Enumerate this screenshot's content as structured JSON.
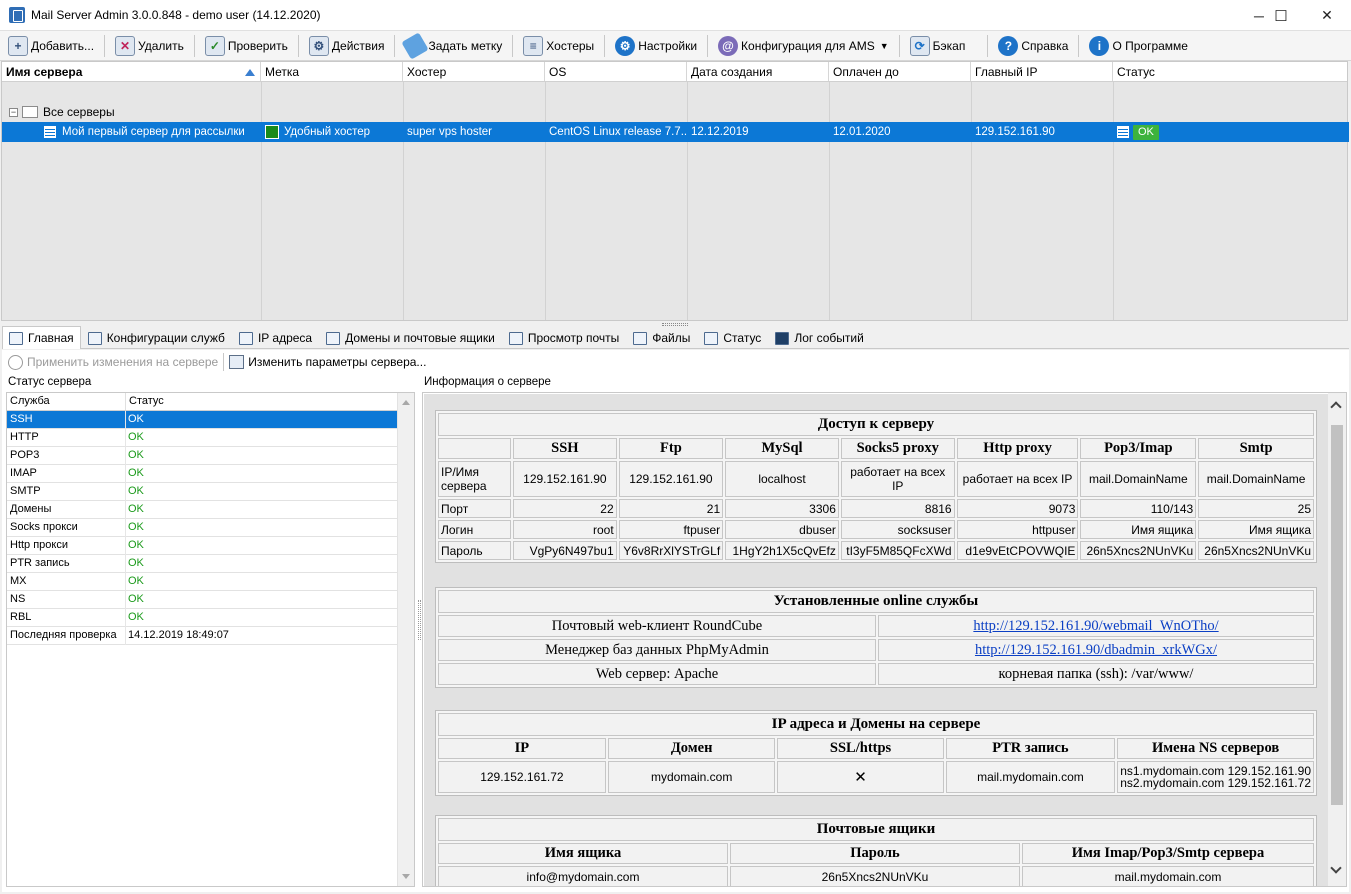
{
  "window": {
    "title": "Mail Server Admin 3.0.0.848 - demo user (14.12.2020)",
    "controls": {
      "minimize": "─",
      "maximize": "☐",
      "close": "✕"
    }
  },
  "toolbar": {
    "add": "Добавить...",
    "delete": "Удалить",
    "check": "Проверить",
    "actions": "Действия",
    "set_tag": "Задать метку",
    "hosters": "Хостеры",
    "settings": "Настройки",
    "ams_config": "Конфигурация для AMS",
    "backup": "Бэкап",
    "help": "Справка",
    "about": "О Программе"
  },
  "grid": {
    "columns": [
      "Имя сервера",
      "Метка",
      "Хостер",
      "OS",
      "Дата создания",
      "Оплачен до",
      "Главный IP",
      "Статус"
    ],
    "root_node": "Все серверы",
    "server_row": {
      "name": "Мой первый сервер для рассылки",
      "tag": "Удобный хостер",
      "tag_color": "#1a8a1a",
      "hoster": "super vps hoster",
      "os": "CentOS Linux release 7.7....",
      "created": "12.12.2019",
      "paid_until": "12.01.2020",
      "main_ip": "129.152.161.90",
      "status": "OK"
    }
  },
  "tabs": [
    {
      "label": "Главная",
      "active": true
    },
    {
      "label": "Конфигурации служб",
      "active": false
    },
    {
      "label": "IP адреса",
      "active": false
    },
    {
      "label": "Домены и почтовые ящики",
      "active": false
    },
    {
      "label": "Просмотр почты",
      "active": false
    },
    {
      "label": "Файлы",
      "active": false
    },
    {
      "label": "Статус",
      "active": false
    },
    {
      "label": "Лог событий",
      "active": false
    }
  ],
  "subbar": {
    "apply": "Применить изменения на сервере",
    "edit_params": "Изменить параметры сервера..."
  },
  "status_panel": {
    "title": "Статус сервера",
    "headers": [
      "Служба",
      "Статус"
    ],
    "rows": [
      {
        "service": "SSH",
        "status": "OK"
      },
      {
        "service": "HTTP",
        "status": "OK"
      },
      {
        "service": "POP3",
        "status": "OK"
      },
      {
        "service": "IMAP",
        "status": "OK"
      },
      {
        "service": "SMTP",
        "status": "OK"
      },
      {
        "service": "Домены",
        "status": "OK"
      },
      {
        "service": "Socks прокси",
        "status": "OK"
      },
      {
        "service": "Http прокси",
        "status": "OK"
      },
      {
        "service": "PTR запись",
        "status": "OK"
      },
      {
        "service": "MX",
        "status": "OK"
      },
      {
        "service": "NS",
        "status": "OK"
      },
      {
        "service": "RBL",
        "status": "OK"
      },
      {
        "service": "Последняя проверка",
        "status": "14.12.2019 18:49:07"
      }
    ]
  },
  "info_panel": {
    "title": "Информация о сервере",
    "access": {
      "caption": "Доступ к серверу",
      "columns": [
        "SSH",
        "Ftp",
        "MySql",
        "Socks5 proxy",
        "Http proxy",
        "Pop3/Imap",
        "Smtp"
      ],
      "rows": [
        {
          "label": "IP/Имя сервера",
          "values": [
            "129.152.161.90",
            "129.152.161.90",
            "localhost",
            "работает на всех IP",
            "работает на всех IP",
            "mail.DomainName",
            "mail.DomainName"
          ]
        },
        {
          "label": "Порт",
          "values": [
            "22",
            "21",
            "3306",
            "8816",
            "9073",
            "110/143",
            "25"
          ]
        },
        {
          "label": "Логин",
          "values": [
            "root",
            "ftpuser",
            "dbuser",
            "socksuser",
            "httpuser",
            "Имя ящика",
            "Имя ящика"
          ]
        },
        {
          "label": "Пароль",
          "values": [
            "VgPy6N497bu1",
            "Y6v8RrXlYSTrGLf",
            "1HgY2h1X5cQvEfz",
            "tI3yF5M85QFcXWd",
            "d1e9vEtCPOVWQIE",
            "26n5Xncs2NUnVKu",
            "26n5Xncs2NUnVKu"
          ]
        }
      ]
    },
    "services": {
      "caption": "Установленные online службы",
      "rows": [
        {
          "name": "Почтовый web-клиент RoundCube",
          "value": "http://129.152.161.90/webmail_WnOTho/",
          "link": true
        },
        {
          "name": "Менеджер баз данных PhpMyAdmin",
          "value": "http://129.152.161.90/dbadmin_xrkWGx/",
          "link": true
        },
        {
          "name": "Web сервер: Apache",
          "value": "корневая папка (ssh): /var/www/",
          "link": false
        }
      ]
    },
    "ips": {
      "caption": "IP адреса и Домены на сервере",
      "columns": [
        "IP",
        "Домен",
        "SSL/https",
        "PTR запись",
        "Имена NS серверов"
      ],
      "row": {
        "ip": "129.152.161.72",
        "domain": "mydomain.com",
        "ssl": "✕",
        "ptr": "mail.mydomain.com",
        "ns1": "ns1.mydomain.com 129.152.161.90",
        "ns2": "ns2.mydomain.com 129.152.161.72"
      }
    },
    "mailboxes": {
      "caption": "Почтовые ящики",
      "columns": [
        "Имя ящика",
        "Пароль",
        "Имя Imap/Pop3/Smtp сервера"
      ],
      "row": [
        "info@mydomain.com",
        "26n5Xncs2NUnVKu",
        "mail.mydomain.com"
      ]
    }
  }
}
